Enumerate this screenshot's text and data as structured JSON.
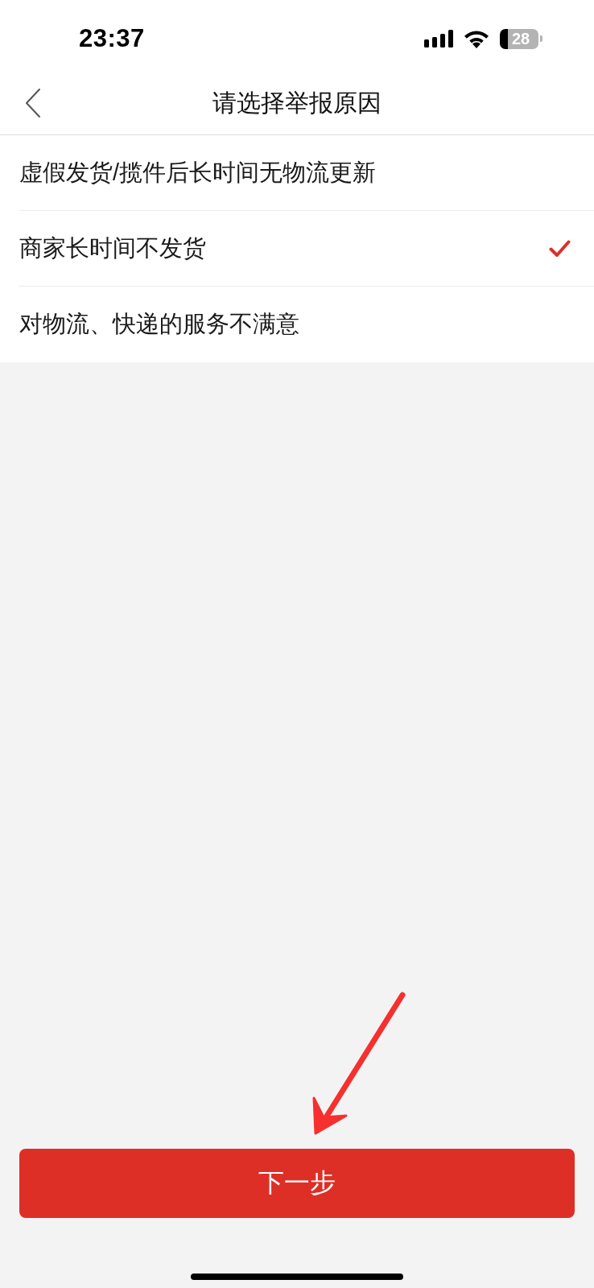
{
  "status_bar": {
    "time": "23:37",
    "battery": "28"
  },
  "nav_bar": {
    "title": "请选择举报原因"
  },
  "reasons": [
    {
      "label": "虚假发货/揽件后长时间无物流更新",
      "selected": false
    },
    {
      "label": "商家长时间不发货",
      "selected": true
    },
    {
      "label": "对物流、快递的服务不满意",
      "selected": false
    }
  ],
  "next_button": {
    "label": "下一步"
  }
}
